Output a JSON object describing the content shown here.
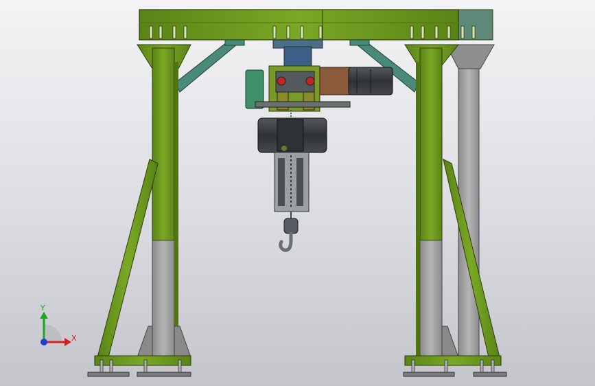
{
  "viewport": {
    "background_top": "#f4f4f6",
    "background_bottom": "#c4c5cb"
  },
  "colors": {
    "frame_green": "#6e9a1c",
    "frame_green_dark": "#4f7410",
    "frame_edge": "#2d3a0a",
    "brace_teal": "#4a8a78",
    "column_grey": "#9a9a9a",
    "motor_dark": "#3c4044",
    "gear_bronze": "#8a5a3a",
    "housing_teal": "#3f8f6a",
    "hoist_grey": "#3e4448"
  },
  "triad": {
    "y_label": "Y",
    "x_label": "X",
    "y_color": "#1fa51f",
    "x_color": "#d42020",
    "z_color": "#1f3fd4"
  },
  "icons": {
    "triad": "coordinate-triad-icon",
    "hook": "crane-hook-icon"
  }
}
